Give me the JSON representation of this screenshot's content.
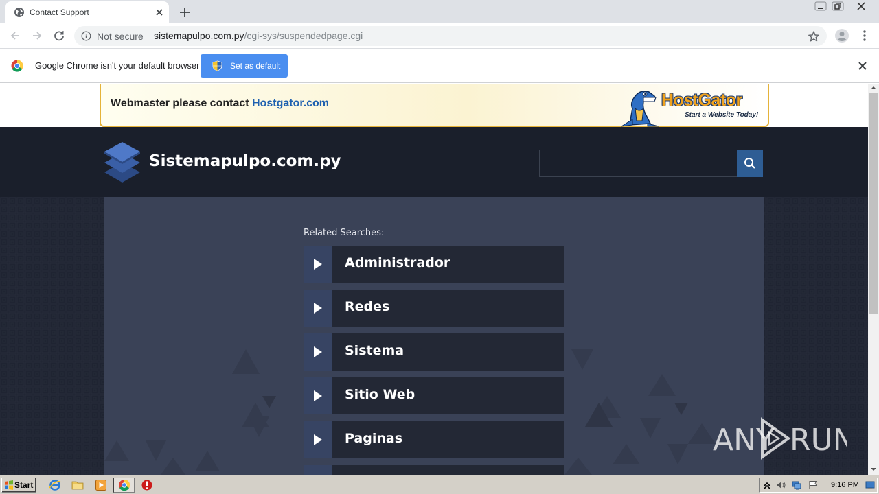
{
  "browser": {
    "tab_title": "Contact Support",
    "security_label": "Not secure",
    "url_host": "sistemapulpo.com.py",
    "url_path": "/cgi-sys/suspendedpage.cgi"
  },
  "infobar": {
    "message": "Google Chrome isn't your default browser",
    "button_label": "Set as default"
  },
  "banner": {
    "text": "Webmaster please contact ",
    "link_text": "Hostgator.com",
    "brand": "HostGator",
    "tagline": "Start a Website Today!"
  },
  "site": {
    "name": "Sistemapulpo.com.py",
    "search_placeholder": ""
  },
  "related": {
    "label": "Related Searches:",
    "items": [
      {
        "label": "Administrador"
      },
      {
        "label": "Redes"
      },
      {
        "label": "Sistema"
      },
      {
        "label": "Sitio Web"
      },
      {
        "label": "Paginas"
      },
      {
        "label": ""
      }
    ]
  },
  "watermark": {
    "left": "ANY",
    "right": "RUN"
  },
  "taskbar": {
    "start_label": "Start",
    "clock": "9:16 PM"
  },
  "colors": {
    "header_bg": "#1a1f2b",
    "panel_bg": "#3a4257",
    "accent_blue": "#2e5d94",
    "chrome_button": "#4a8ef0",
    "hostgator_orange": "#f0a21d"
  },
  "icons": [
    "globe-icon",
    "close-icon",
    "plus-icon",
    "back-icon",
    "forward-icon",
    "reload-icon",
    "info-icon",
    "star-icon",
    "profile-icon",
    "menu-icon",
    "chrome-logo-icon",
    "shield-icon",
    "search-icon",
    "layers-logo-icon",
    "play-arrow-icon",
    "windows-flag-icon",
    "ie-icon",
    "folder-icon",
    "media-player-icon",
    "chrome-icon",
    "opera-icon",
    "speaker-icon",
    "network-icon",
    "flag-icon"
  ]
}
